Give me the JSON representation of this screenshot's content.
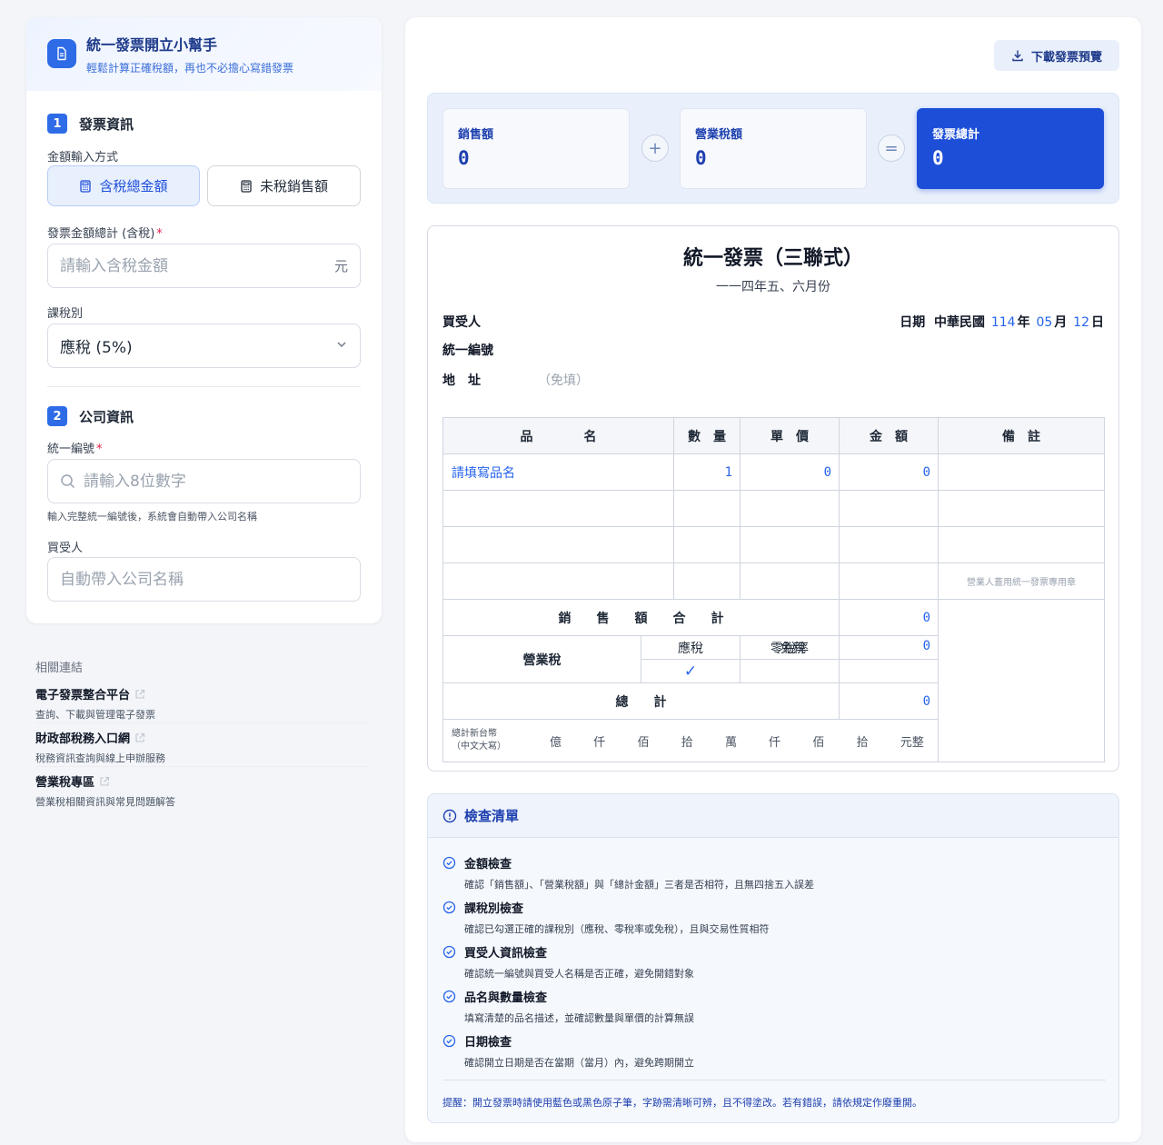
{
  "app": {
    "title": "統一發票開立小幫手",
    "subtitle": "輕鬆計算正確稅額，再也不必擔心寫錯發票"
  },
  "section1": {
    "num": "1",
    "title": "發票資訊",
    "input_mode_label": "金額輸入方式",
    "mode_taxed": "含稅總金額",
    "mode_untaxed": "未稅銷售額",
    "amount_label": "發票金額總計 (含稅)",
    "required_mark": "*",
    "amount_placeholder": "請輸入含稅金額",
    "amount_suffix": "元",
    "tax_type_label": "課稅別",
    "tax_type_value": "應稅 (5%)"
  },
  "section2": {
    "num": "2",
    "title": "公司資訊",
    "tax_id_label": "統一編號",
    "required_mark": "*",
    "tax_id_placeholder": "請輸入8位數字",
    "tax_id_hint": "輸入完整統一編號後，系統會自動帶入公司名稱",
    "buyer_label": "買受人",
    "buyer_placeholder": "自動帶入公司名稱"
  },
  "links": {
    "title": "相關連結",
    "items": [
      {
        "title": "電子發票整合平台",
        "desc": "查詢、下載與管理電子發票"
      },
      {
        "title": "財政部稅務入口網",
        "desc": "稅務資訊查詢與線上申辦服務"
      },
      {
        "title": "營業稅專區",
        "desc": "營業稅相關資訊與常見問題解答"
      }
    ]
  },
  "toolbar": {
    "download_label": "下載發票預覽"
  },
  "summary": {
    "sales_label": "銷售額",
    "sales_value": "0",
    "plus": "+",
    "tax_label": "營業稅額",
    "tax_value": "0",
    "equals": "=",
    "total_label": "發票總計",
    "total_value": "0"
  },
  "invoice": {
    "title": "統一發票（三聯式）",
    "period": "一一四年五、六月份",
    "buyer_label": "買受人",
    "tax_id_label": "統一編號",
    "address_label": "地　址",
    "address_optional": "（免填）",
    "date_label": "日期",
    "date_era": "中華民國",
    "date_year": "114",
    "year_unit": "年",
    "date_month": "05",
    "month_unit": "月",
    "date_day": "12",
    "day_unit": "日",
    "headers": {
      "item": "品　　　　名",
      "qty": "數　量",
      "price": "單　價",
      "amount": "金　額",
      "note": "備　註"
    },
    "row1": {
      "item": "請填寫品名",
      "qty": "1",
      "price": "0",
      "amount": "0"
    },
    "stamp_note": "營業人蓋用統一發票專用章",
    "sales_total_label": "銷　　售　　額　　合　　計",
    "sales_total_value": "0",
    "tax_label": "營業稅",
    "tax_col_taxable": "應稅",
    "tax_col_zero": "零稅率",
    "tax_col_exempt": "免稅",
    "tax_check": "✓",
    "tax_value": "0",
    "grand_total_label": "總　　計",
    "grand_total_value": "0",
    "chinese_total_label_1": "總計新台幣",
    "chinese_total_label_2": "（中文大寫）",
    "units": [
      "億",
      "仟",
      "佰",
      "拾",
      "萬",
      "仟",
      "佰",
      "拾",
      "元整"
    ]
  },
  "checklist": {
    "title": "檢查清單",
    "items": [
      {
        "title": "金額檢查",
        "desc": "確認「銷售額」、「營業稅額」與「總計金額」三者是否相符，且無四捨五入誤差"
      },
      {
        "title": "課稅別檢查",
        "desc": "確認已勾選正確的課稅別（應稅、零稅率或免稅），且與交易性質相符"
      },
      {
        "title": "買受人資訊檢查",
        "desc": "確認統一編號與買受人名稱是否正確，避免開錯對象"
      },
      {
        "title": "品名與數量檢查",
        "desc": "填寫清楚的品名描述，並確認數量與單價的計算無誤"
      },
      {
        "title": "日期檢查",
        "desc": "確認開立日期是否在當期（當月）內，避免跨期開立"
      }
    ],
    "note": "提醒：開立發票時請使用藍色或黑色原子筆，字跡需清晰可辨，且不得塗改。若有錯誤，請依規定作廢重開。"
  },
  "colors": {
    "accent": "#2e6be6",
    "accent_dark": "#1d4ed8",
    "required": "#e11d48"
  }
}
